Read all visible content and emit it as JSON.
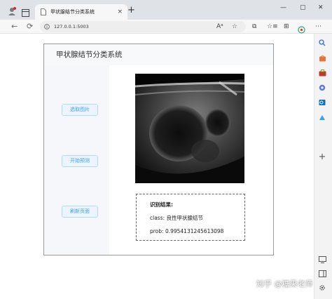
{
  "browser": {
    "tab_title": "甲状腺结节分类系统",
    "tab_close": "×",
    "new_tab": "+",
    "window_controls": {
      "minimize": "—",
      "maximize": "▢",
      "close": "✕"
    },
    "address": "127.0.0.1:5003",
    "nav": {
      "back": "←",
      "reload": "⟳"
    },
    "toolbar_icons": {
      "read_aloud": "Aᵃ",
      "favorite": "☆",
      "split": "⧉",
      "favorites": "☆≡",
      "collections": "⊞",
      "more": "⋯"
    }
  },
  "app": {
    "title": "甲状腺结节分类系统",
    "buttons": {
      "select_image": "选取图片",
      "start_predict": "开始预测",
      "refresh_page": "刷新页面"
    },
    "result": {
      "heading": "识别结果:",
      "class_line": "class: 良性甲状腺结节",
      "prob_line": "prob: 0.9954131245613098"
    }
  },
  "watermark": "知乎 @糖果老师",
  "colors": {
    "button_text": "#409eff",
    "button_bg": "#ecf5ff",
    "button_border": "#b3d8ff",
    "tabbar_bg": "#dfe3e8"
  }
}
